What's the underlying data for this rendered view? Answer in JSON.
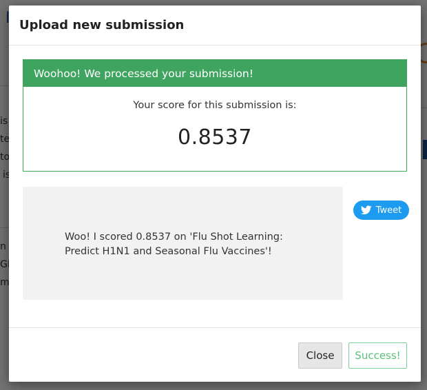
{
  "modal": {
    "title": "Upload new submission",
    "banner": "Woohoo! We processed your submission!",
    "score_label": "Your score for this submission is:",
    "score_value": "0.8537",
    "share_text": "Woo! I scored 0.8537 on 'Flu Shot Learning: Predict H1N1 and Seasonal Flu Vaccines'!",
    "tweet_label": "Tweet",
    "close_label": "Close",
    "success_label": "Success!"
  },
  "background": {
    "fragments": [
      "I",
      "is",
      "te",
      "to",
      "is",
      "n a",
      "GI",
      "m"
    ]
  },
  "colors": {
    "success_green": "#40a461",
    "twitter_blue": "#1d9bf0",
    "outline_green": "#5bbf7a"
  }
}
